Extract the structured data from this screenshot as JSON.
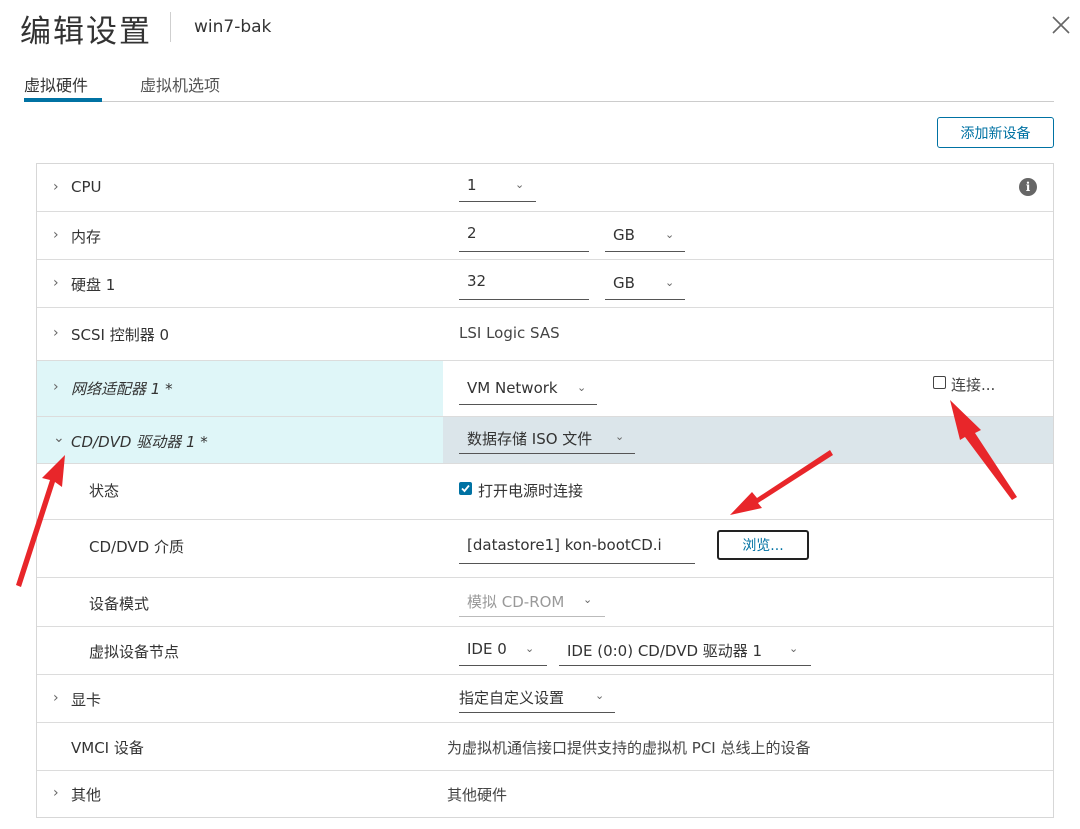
{
  "header": {
    "title": "编辑设置",
    "vm_name": "win7-bak",
    "close_icon": "close-icon"
  },
  "tabs": [
    {
      "label": "虚拟硬件",
      "active": true
    },
    {
      "label": "虚拟机选项",
      "active": false
    }
  ],
  "toolbar": {
    "add_device_label": "添加新设备"
  },
  "hardware": {
    "cpu": {
      "label": "CPU",
      "value": "1"
    },
    "memory": {
      "label": "内存",
      "value": "2",
      "unit": "GB"
    },
    "disk": {
      "label": "硬盘 1",
      "value": "32",
      "unit": "GB"
    },
    "scsi": {
      "label": "SCSI 控制器 0",
      "value": "LSI Logic SAS"
    },
    "network": {
      "label": "网络适配器 1 *",
      "value": "VM Network",
      "connect_label": "连接..."
    },
    "cddvd": {
      "label": "CD/DVD 驱动器 1 *",
      "value": "数据存储 ISO 文件",
      "status_label": "状态",
      "status_value": "打开电源时连接",
      "media_label": "CD/DVD 介质",
      "media_value": "[datastore1] kon-bootCD.i",
      "browse_label": "浏览...",
      "mode_label": "设备模式",
      "mode_value": "模拟 CD-ROM",
      "node_label": "虚拟设备节点",
      "node_bus": "IDE 0",
      "node_value": "IDE (0:0) CD/DVD 驱动器 1"
    },
    "video": {
      "label": "显卡",
      "value": "指定自定义设置"
    },
    "vmci": {
      "label": "VMCI 设备",
      "value": "为虚拟机通信接口提供支持的虚拟机 PCI 总线上的设备"
    },
    "other": {
      "label": "其他",
      "value": "其他硬件"
    }
  },
  "icons": {
    "chevron_right": "›",
    "chevron_down": "⌄",
    "info": "i",
    "checkmark": "✓"
  },
  "colors": {
    "accent": "#0072a3",
    "highlight_left": "#dff6f8",
    "highlight_right": "#dbe5ea",
    "annotation_arrow": "#e8262a"
  }
}
